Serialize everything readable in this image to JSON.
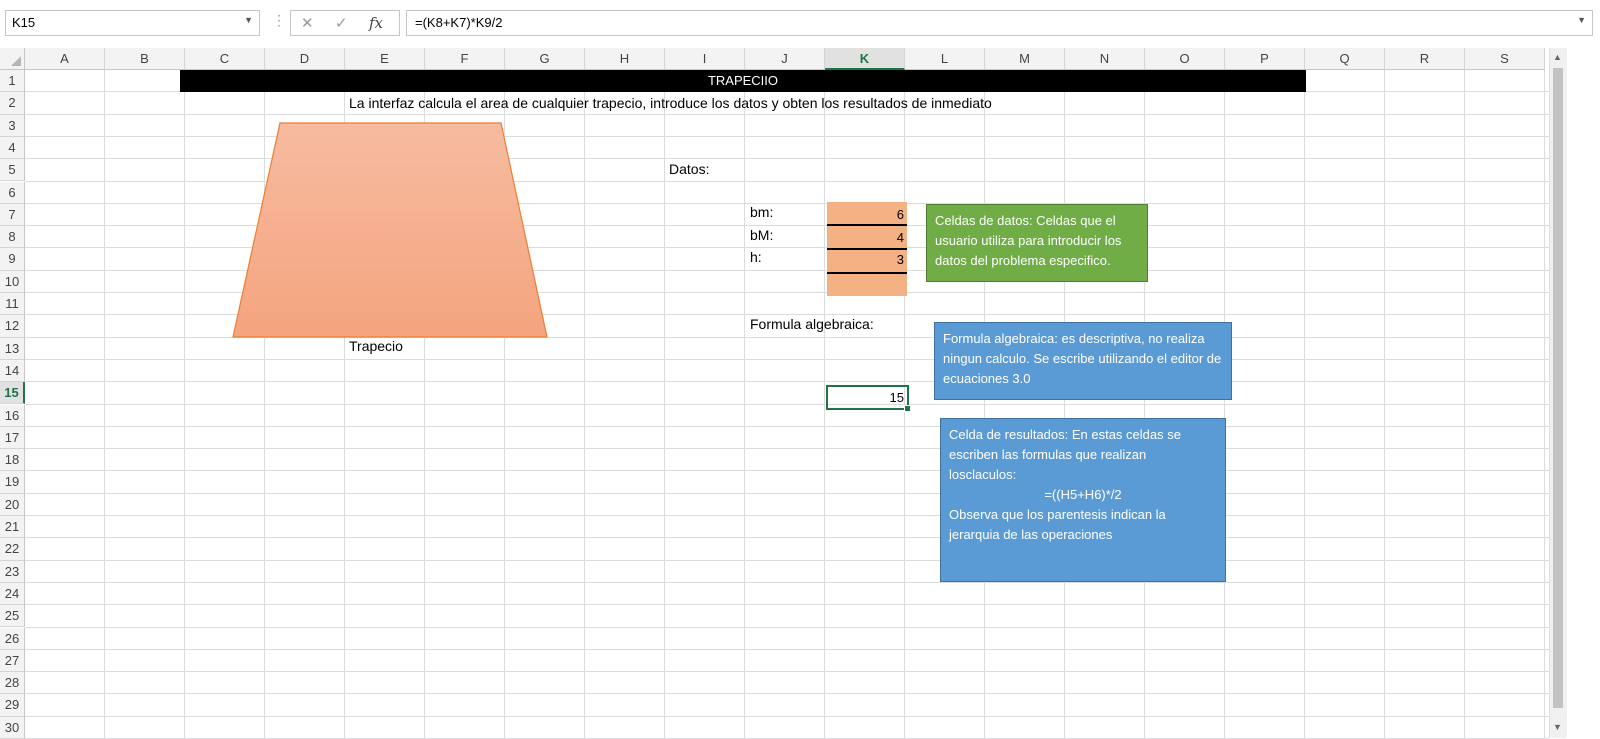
{
  "formula_bar": {
    "name_box": "K15",
    "cancel_glyph": "✕",
    "enter_glyph": "✓",
    "fx_glyph": "fx",
    "formula": "=(K8+K7)*K9/2"
  },
  "columns": [
    "A",
    "B",
    "C",
    "D",
    "E",
    "F",
    "G",
    "H",
    "I",
    "J",
    "K",
    "L",
    "M",
    "N",
    "O",
    "P",
    "Q",
    "R",
    "S"
  ],
  "selected_column": "K",
  "rows": [
    "1",
    "2",
    "3",
    "4",
    "5",
    "6",
    "7",
    "8",
    "9",
    "10",
    "11",
    "12",
    "13",
    "14",
    "15",
    "16",
    "17",
    "18",
    "19",
    "20",
    "21",
    "22",
    "23",
    "24",
    "25",
    "26",
    "27",
    "28",
    "29",
    "30"
  ],
  "selected_row": "15",
  "sheet": {
    "title": "TRAPECIIO",
    "description": "La interfaz calcula el area de cualquier trapecio, introduce los datos y obten los resultados de inmediato",
    "shape_label": "Trapecio",
    "datos_label": "Datos:",
    "inputs": [
      {
        "label": "bm:",
        "value": "6"
      },
      {
        "label": "bM:",
        "value": "4"
      },
      {
        "label": "h:",
        "value": "3"
      }
    ],
    "formula_label": "Formula algebraica:",
    "result": "15"
  },
  "notes": {
    "green": "Celdas de datos: Celdas que el usuario utiliza para introducir los datos del problema especifico.",
    "blue_formula": "Formula algebraica: es descriptiva, no realiza ningun calculo. Se escribe utilizando el editor de ecuaciones 3.0",
    "blue_result_1": "Celda de resultados: En estas celdas se escriben las formulas que realizan losclaculos:",
    "blue_result_formula": "=((H5+H6)*/2",
    "blue_result_2": "Observa que los parentesis indican la jerarquia de las operaciones"
  },
  "colors": {
    "header_black": "#000000",
    "input_orange": "#f4b183",
    "shape_orange": "#f5ad8a",
    "note_green": "#70ad47",
    "note_blue": "#5b9bd5",
    "selection_green": "#217346"
  }
}
